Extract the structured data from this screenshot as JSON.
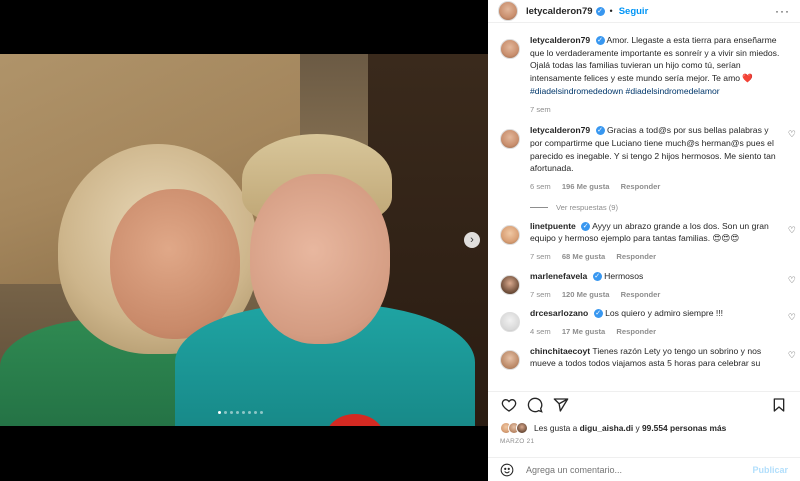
{
  "post": {
    "username": "letycalderon79",
    "follow_label": "Seguir",
    "separator": "•",
    "more_icon": "more-horizontal-icon"
  },
  "caption": {
    "username": "letycalderon79",
    "text": "Amor. Llegaste a esta tierra para enseñarme que lo verdaderamente importante es sonreír y a vivir sin miedos. Ojalá todas las familias tuvieran un hijo como tú, serían intensamente felices y este mundo sería mejor. Te amo ❤️ ",
    "hashtags": "#diadelsindromededown #diadelsindromedelamor",
    "time": "7 sem"
  },
  "comments": [
    {
      "username": "letycalderon79",
      "verified": true,
      "text": "Gracias a tod@s por sus bellas palabras y por compartirme que Luciano tiene much@s herman@s pues el parecido es inegable. Y si tengo 2 hijos hermosos. Me siento tan afortunada.",
      "time": "6 sem",
      "likes": "196 Me gusta",
      "reply": "Responder",
      "view_replies": "Ver respuestas (9)"
    },
    {
      "username": "linetpuente",
      "verified": true,
      "text": "Ayyy un abrazo grande a los dos. Son un gran equipo y hermoso ejemplo para tantas familias. 😍😍😍",
      "time": "7 sem",
      "likes": "68 Me gusta",
      "reply": "Responder"
    },
    {
      "username": "marlenefavela",
      "verified": true,
      "text": "Hermosos",
      "time": "7 sem",
      "likes": "120 Me gusta",
      "reply": "Responder"
    },
    {
      "username": "drcesarlozano",
      "verified": true,
      "text": "Los quiero y admiro siempre !!!",
      "time": "4 sem",
      "likes": "17 Me gusta",
      "reply": "Responder"
    },
    {
      "username": "chinchitaecoyt",
      "verified": false,
      "text": "Tienes razón Lety yo tengo un sobrino y nos mueve a todos todos viajamos asta 5 horas para celebrar su"
    }
  ],
  "likes": {
    "prefix": "Les gusta a ",
    "user": "digu_aisha.di",
    "middle": " y ",
    "count": "99.554 personas más"
  },
  "date": "MARZO 21",
  "add_comment": {
    "placeholder": "Agrega un comentario...",
    "publish_label": "Publicar"
  },
  "carousel": {
    "total_slides": 8,
    "active_slide": 1
  },
  "colors": {
    "accent": "#0095f6",
    "verified": "#3897f0",
    "muted": "#8e8e8e",
    "publish_disabled": "#b2dffc"
  }
}
